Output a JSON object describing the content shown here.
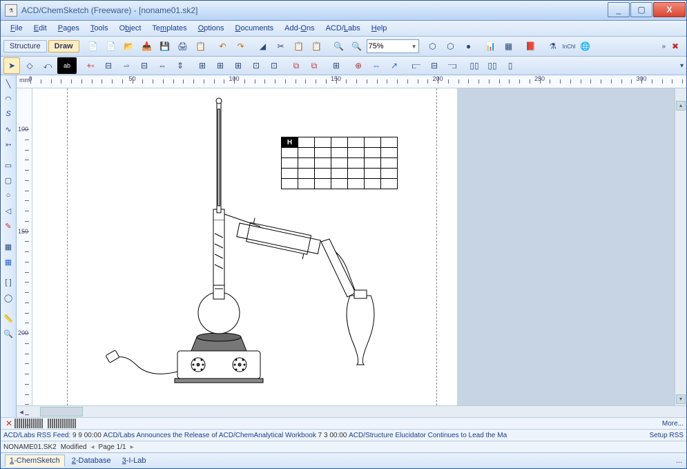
{
  "window": {
    "title": "ACD/ChemSketch (Freeware) - [noname01.sk2]",
    "min": "_",
    "max": "▢",
    "close": "X"
  },
  "menus": [
    "File",
    "Edit",
    "Pages",
    "Tools",
    "Object",
    "Templates",
    "Options",
    "Documents",
    "Add-Ons",
    "ACD/Labs",
    "Help"
  ],
  "mode": {
    "structure": "Structure",
    "draw": "Draw"
  },
  "zoom": "75%",
  "inchi_label": "InChI",
  "ruler_unit": "mm",
  "ruler_x": [
    0,
    50,
    100,
    150,
    200,
    250,
    300
  ],
  "ruler_y": [
    100,
    150,
    200
  ],
  "grid_label": "H",
  "palette_colors": [
    "#000000",
    "#800000",
    "#ff0000",
    "#808000",
    "#ffff00",
    "#008000",
    "#00ff00",
    "#008080",
    "#00ffff",
    "#000080",
    "#0000ff",
    "#800080",
    "#ff00ff",
    "#c0c0c0"
  ],
  "more": "More...",
  "rss": {
    "prefix": "ACD/Labs RSS Feed:",
    "item1_time": "9 9 00:00",
    "item1_text": "ACD/Labs Announces the Release of ACD/ChemAnalytical Workbook",
    "item2_time": "7 3 00:00",
    "item2_text": "ACD/Structure Elucidator Continues to Lead the Ma",
    "setup": "Setup RSS"
  },
  "status": {
    "file": "NONAME01.SK2",
    "modified": "Modified",
    "page": "Page 1/1"
  },
  "tabs": [
    "1-ChemSketch",
    "2-Database",
    "3-I-Lab"
  ],
  "dots": "..."
}
